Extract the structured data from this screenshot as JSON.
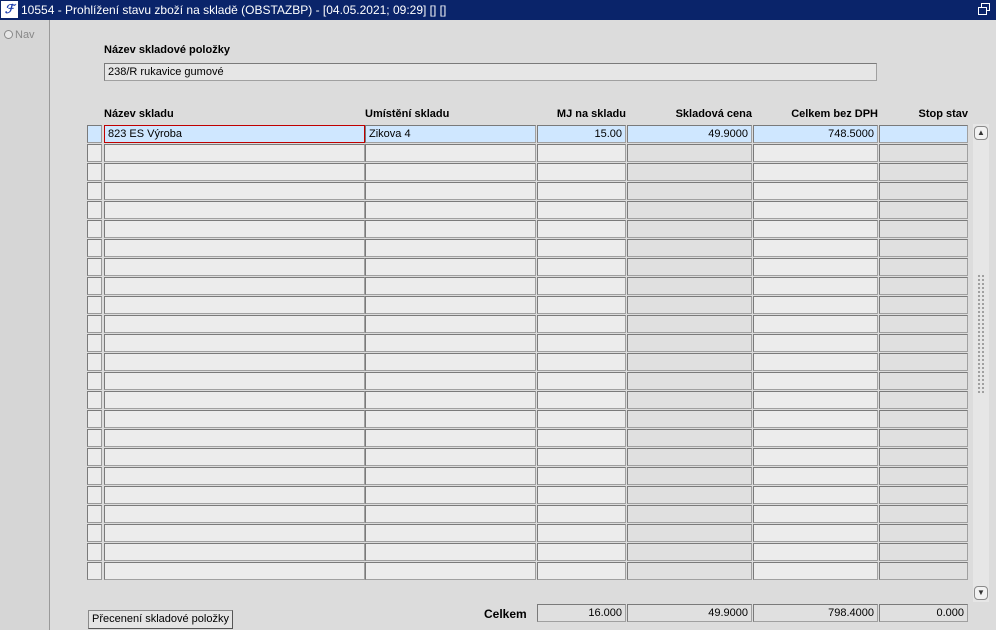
{
  "window": {
    "title": "10554 - Prohlížení stavu zboží na skladě (OBSTAZBP) - [04.05.2021; 09:29]  [] []"
  },
  "nav": {
    "label": "Nav"
  },
  "item": {
    "label": "Název skladové položky",
    "value": "238/R rukavice gumové"
  },
  "table": {
    "columns": [
      "Název skladu",
      "Umístění skladu",
      "MJ na skladu",
      "Skladová cena",
      "Celkem bez DPH",
      "Stop stav"
    ],
    "rows": [
      {
        "sklad": "823 ES Výroba",
        "umisteni": "Zikova 4",
        "mj": "15.00",
        "cena": "49.9000",
        "celkem": "748.5000",
        "stop": ""
      }
    ],
    "visible_row_count": 24
  },
  "footer": {
    "reprice_button": "Přecenení skladové položky",
    "total_label": "Celkem",
    "total_mj": "16.000",
    "total_cena": "49.9000",
    "total_celkem": "798.4000",
    "total_stop": "0.000"
  }
}
